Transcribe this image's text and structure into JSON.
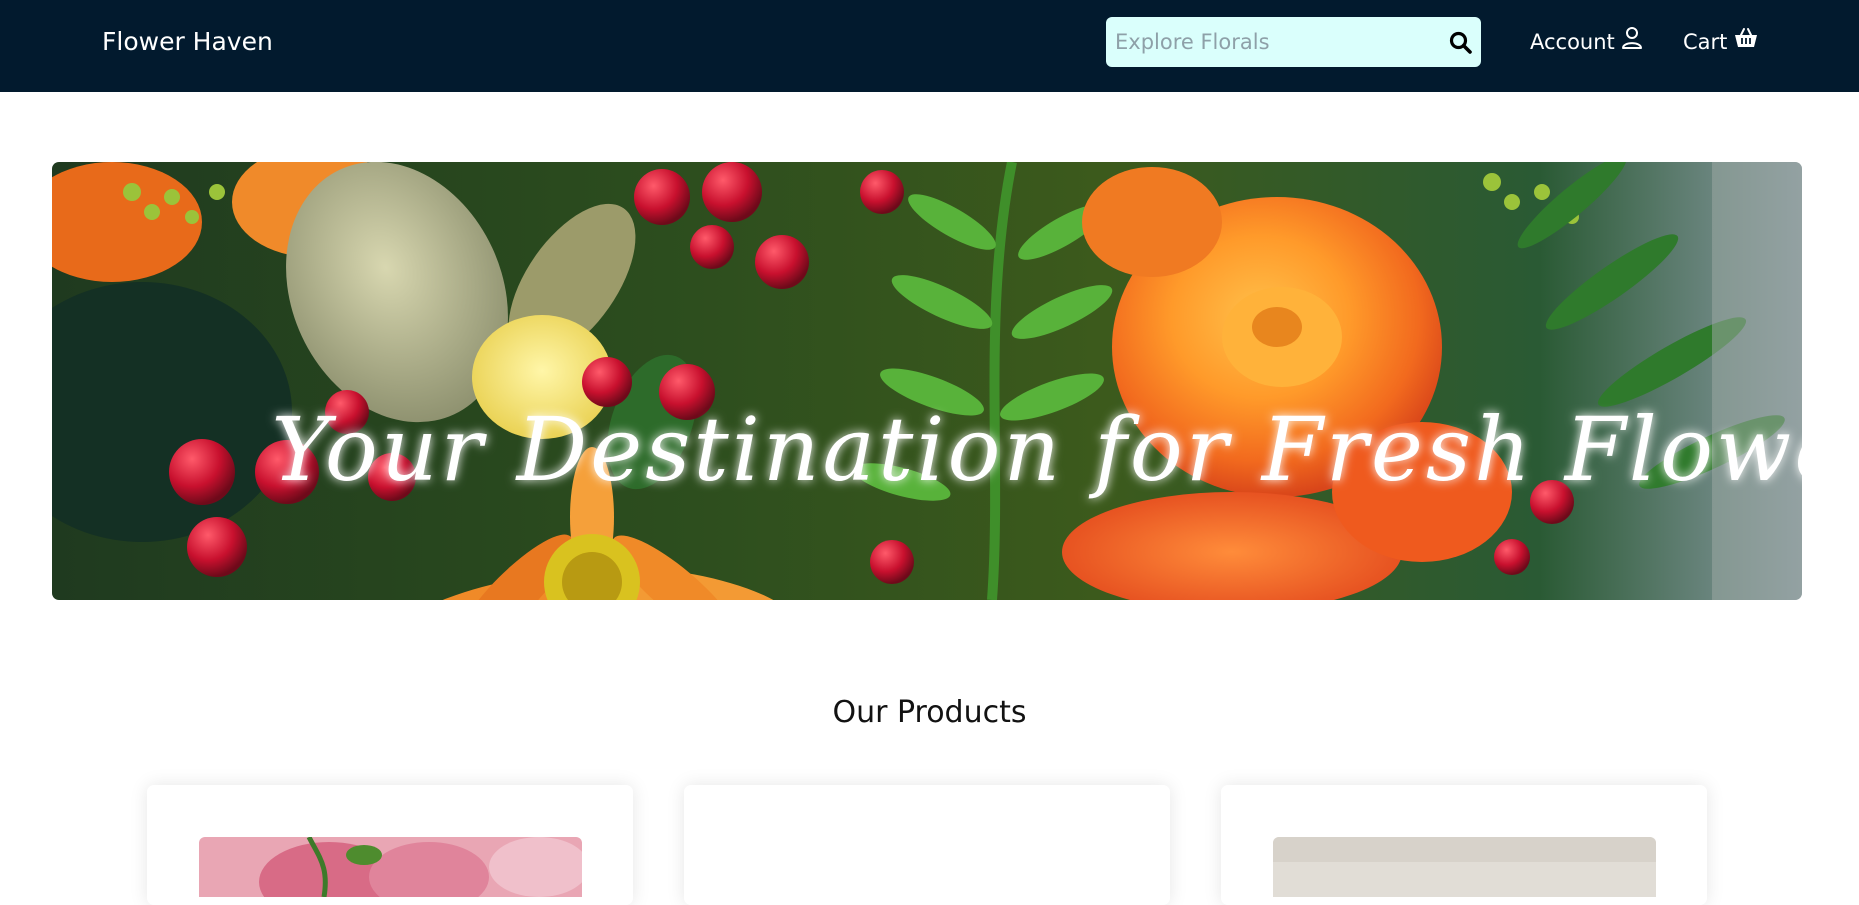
{
  "brand": {
    "name": "Flower Haven"
  },
  "search": {
    "placeholder": "Explore Florals",
    "value": ""
  },
  "nav": {
    "account_label": "Account",
    "cart_label": "Cart"
  },
  "hero": {
    "tagline": "Your Destination for Fresh Flowers"
  },
  "products": {
    "section_title": "Our Products"
  },
  "icons": {
    "search": "search-icon",
    "account": "user-icon",
    "cart": "basket-icon"
  },
  "colors": {
    "navbar_bg": "#021a2e",
    "search_bg": "#dafffc",
    "page_bg": "#ffffff"
  }
}
